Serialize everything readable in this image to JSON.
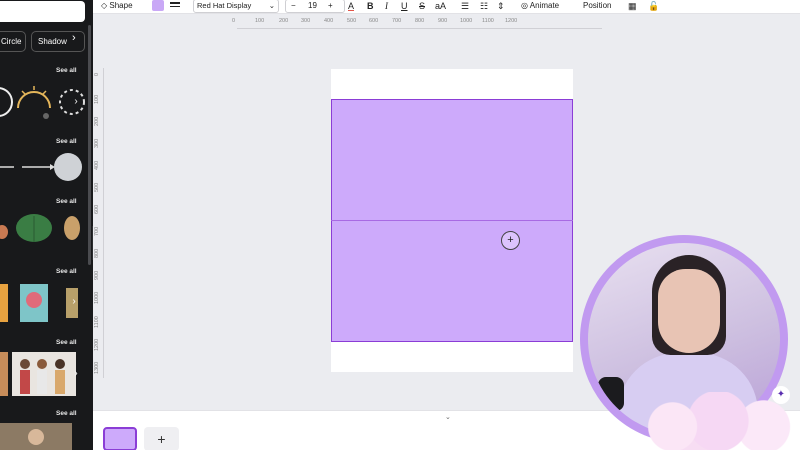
{
  "sidebar": {
    "chips": [
      "Circle",
      "Shadow"
    ],
    "see_all": "See all",
    "rows": 6
  },
  "toolbar": {
    "shape_label": "Shape",
    "font": "Red Hat Display",
    "size": "19",
    "minus": "−",
    "plus": "+",
    "animate_label": "Animate",
    "position_label": "Position",
    "fill_color": "#c9a8f6"
  },
  "ruler": {
    "horizontal": [
      "0",
      "100",
      "200",
      "300",
      "400",
      "500",
      "600",
      "700",
      "800",
      "900",
      "1000",
      "1100",
      "1200"
    ],
    "vertical": [
      "0",
      "100",
      "200",
      "300",
      "400",
      "500",
      "600",
      "700",
      "800",
      "900",
      "1000",
      "1100",
      "1200",
      "1300"
    ]
  },
  "canvas": {
    "rect_color": "#cdaafb",
    "rect_border": "#8b3dd6"
  },
  "pages": {
    "add_label": "+"
  }
}
